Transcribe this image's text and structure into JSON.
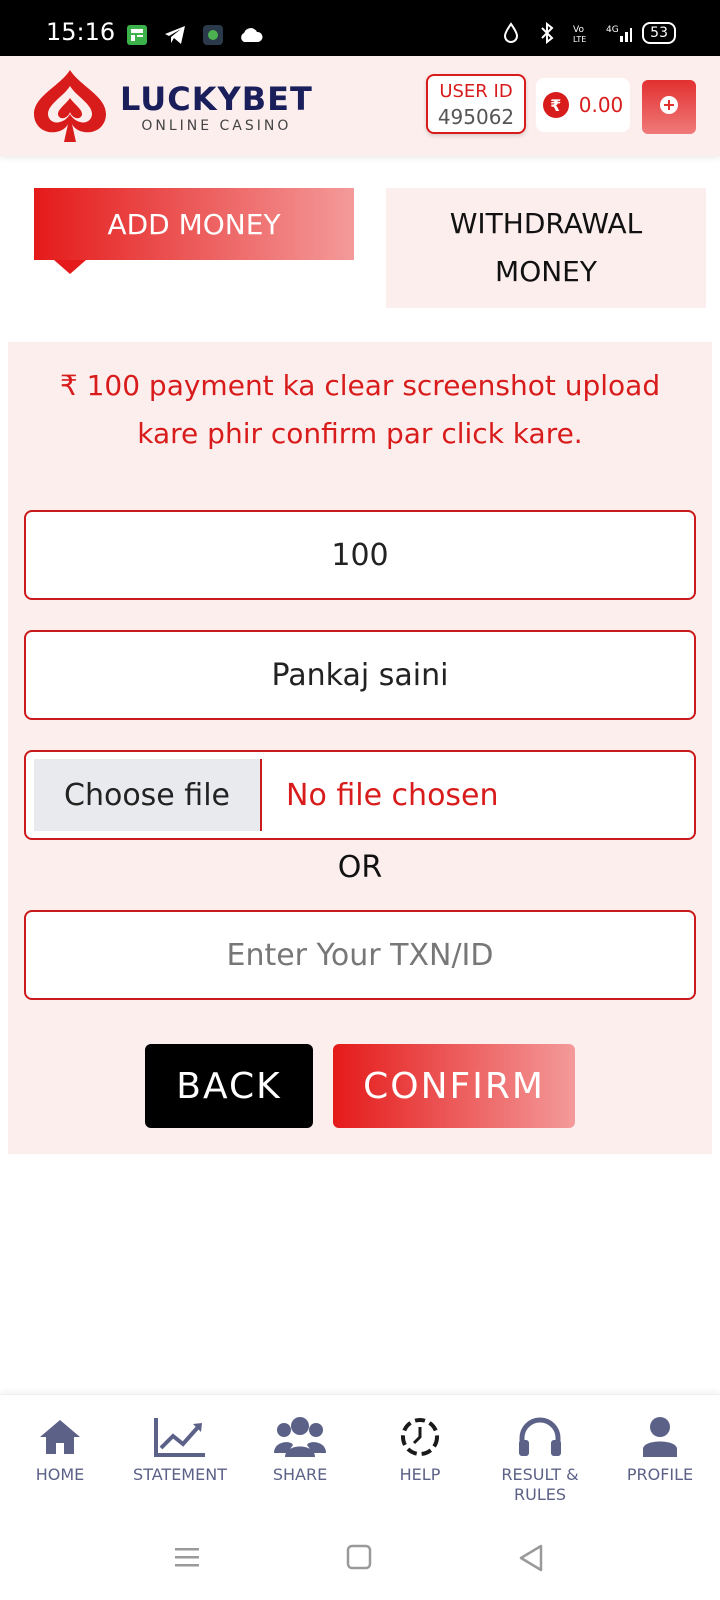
{
  "status_bar": {
    "time": "15:16",
    "battery": "53",
    "network": "4G"
  },
  "header": {
    "brand": "LUCKYBET",
    "tagline": "ONLINE CASINO",
    "user_id_label": "USER ID",
    "user_id": "495062",
    "currency_symbol": "₹",
    "balance": "0.00"
  },
  "tabs": {
    "add_money": "ADD MONEY",
    "withdrawal": "WITHDRAWAL MONEY"
  },
  "form": {
    "notice": "₹ 100 payment ka clear screenshot upload kare phir confirm par click kare.",
    "amount": "100",
    "name": "Pankaj saini",
    "file_button": "Choose file",
    "file_status": "No file chosen",
    "or_label": "OR",
    "txn_placeholder": "Enter Your TXN/ID",
    "back_label": "BACK",
    "confirm_label": "CONFIRM"
  },
  "bottom_nav": {
    "items": [
      {
        "label": "HOME",
        "icon": "home-icon"
      },
      {
        "label": "STATEMENT",
        "icon": "chart-icon"
      },
      {
        "label": "SHARE",
        "icon": "users-icon"
      },
      {
        "label": "HELP",
        "icon": "help-icon"
      },
      {
        "label": "RESULT & RULES",
        "icon": "headphones-icon"
      },
      {
        "label": "PROFILE",
        "icon": "user-icon"
      }
    ]
  },
  "colors": {
    "accent": "#d81c1c",
    "brand_navy": "#1a1f5c",
    "panel_bg": "#fdeeee",
    "nav_icon": "#5c6188"
  }
}
